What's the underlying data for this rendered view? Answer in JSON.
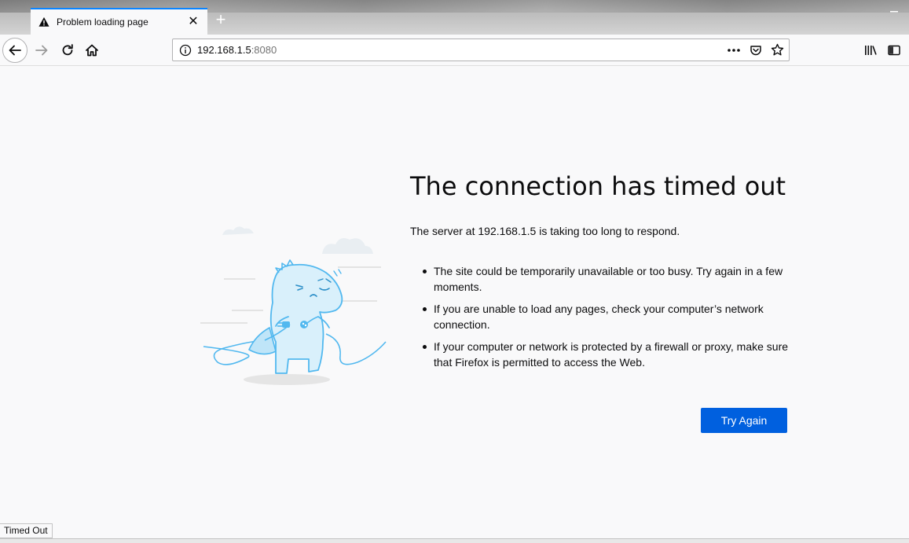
{
  "tab": {
    "title": "Problem loading page",
    "close": "✕",
    "new_tab": "+"
  },
  "navbar": {
    "url_host": "192.168.1.5",
    "url_port": ":8080"
  },
  "error": {
    "title": "The connection has timed out",
    "description": "The server at 192.168.1.5 is taking too long to respond.",
    "items": [
      "The site could be temporarily unavailable or too busy. Try again in a few moments.",
      "If you are unable to load any pages, check your computer’s network connection.",
      "If your computer or network is protected by a firewall or proxy, make sure that Firefox is permitted to access the Web."
    ],
    "button": "Try Again"
  },
  "status": {
    "text": "Timed Out"
  },
  "colors": {
    "accent": "#0a84ff",
    "button": "#0060df",
    "illustration": "#51b8ef"
  }
}
